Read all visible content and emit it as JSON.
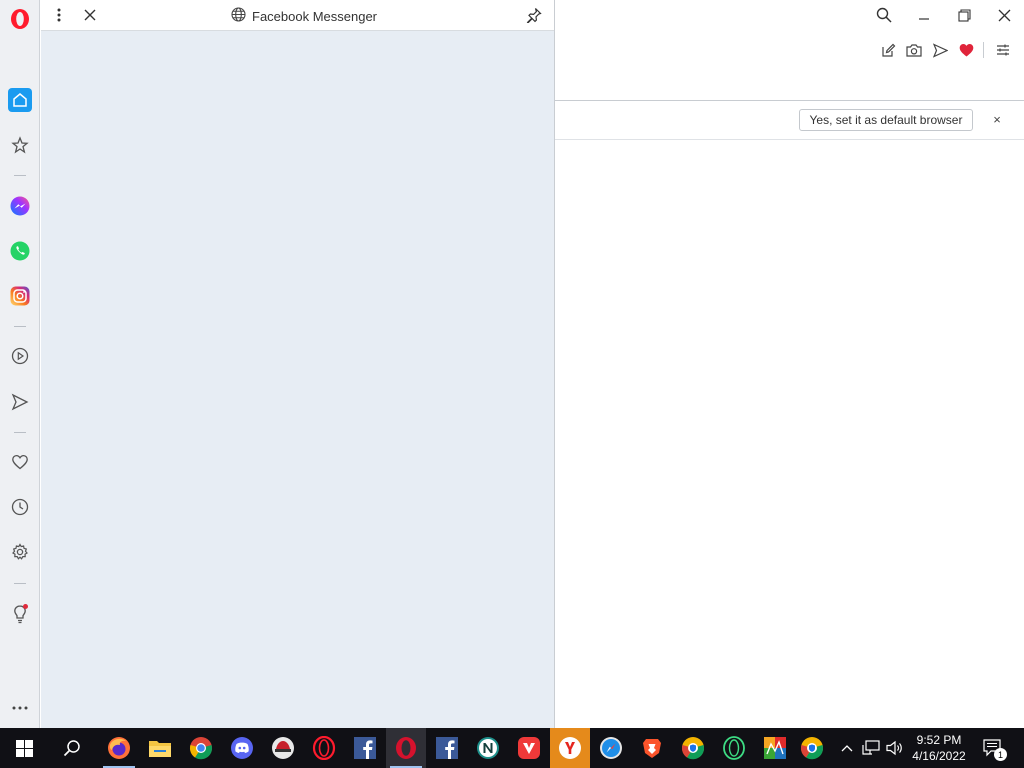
{
  "panel": {
    "title": "Facebook Messenger"
  },
  "default_browser_bar": {
    "button_label": "Yes, set it as default browser",
    "close_label": "×"
  },
  "taskbar": {
    "time": "9:52 PM",
    "date": "4/16/2022",
    "notification_count": "1",
    "apps": [
      "windows-start",
      "search",
      "firefox",
      "file-explorer",
      "chrome",
      "discord",
      "app-red",
      "opera",
      "facebook",
      "opera-gx",
      "facebook",
      "n-browser",
      "vivaldi",
      "yandex",
      "safari",
      "brave",
      "chromium",
      "opera-neon",
      "avg",
      "chromium-2"
    ]
  },
  "colors": {
    "accent": "#1a9bf0",
    "opera_red": "#ff1b2d",
    "panel_bg": "#e7edf4",
    "sidebar_bg": "#eef0f3",
    "taskbar_bg": "#101015"
  }
}
